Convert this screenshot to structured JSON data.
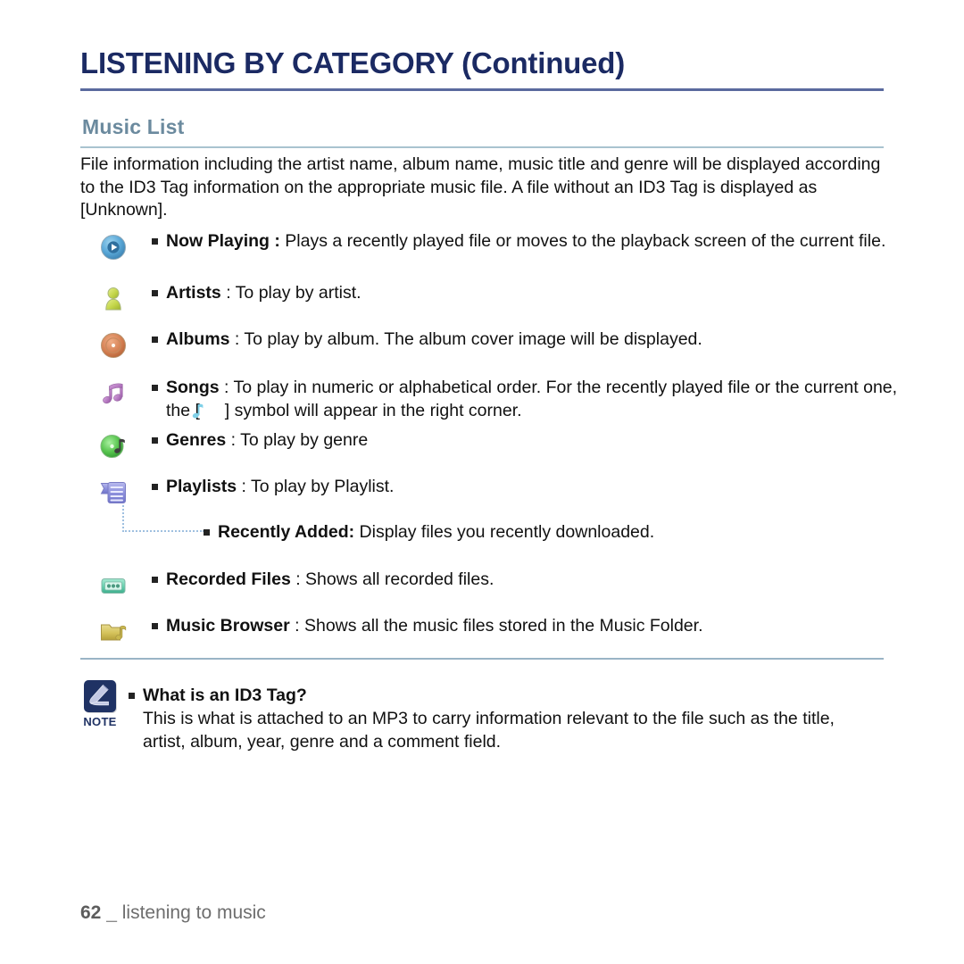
{
  "header": {
    "title": "LISTENING BY CATEGORY (Continued)",
    "section_title": "Music List"
  },
  "intro": "File information including the artist name, album name, music title and genre will be displayed according to the ID3 Tag information on the appropriate music file. A file without an ID3 Tag is displayed as [Unknown].",
  "features": [
    {
      "icon": "now-playing-icon",
      "term": "Now Playing :",
      "desc": " Plays a recently played file or moves to the playback screen of the current file."
    },
    {
      "icon": "artists-icon",
      "term": "Artists",
      "desc": " : To play by artist."
    },
    {
      "icon": "albums-icon",
      "term": "Albums",
      "desc": " : To play by album. The album cover image will be displayed."
    },
    {
      "icon": "songs-icon",
      "term": "Songs",
      "desc_before": " : To play in numeric or alphabetical order. For the recently played file or the current one, the [ ",
      "desc_after": " ] symbol will appear in the right corner."
    },
    {
      "icon": "genres-icon",
      "term": "Genres",
      "desc": " : To play by genre"
    },
    {
      "icon": "playlists-icon",
      "term": "Playlists",
      "desc": " : To play by Playlist."
    },
    {
      "icon": "recorded-files-icon",
      "term": "Recorded Files",
      "desc": " : Shows all recorded files."
    },
    {
      "icon": "music-browser-icon",
      "term": "Music Browser",
      "desc": " : Shows all the music files stored in the Music Folder."
    }
  ],
  "subfeature": {
    "term": "Recently Added:",
    "desc": " Display files you recently downloaded."
  },
  "note": {
    "icon": "note-hand-icon",
    "badge_label": "NOTE",
    "heading": "What is an ID3 Tag?",
    "body": "This is what is attached to an MP3 to carry information relevant to the file such as the title, artist, album, year, genre and a comment field."
  },
  "footer": {
    "page_number": "62",
    "separator": "_",
    "chapter": "listening to music"
  },
  "colors": {
    "title": "#1b2a63",
    "title_rule": "#5a6a9e",
    "section_title": "#6b8a9e",
    "section_rule": "#a9c3cf",
    "note_rule": "#9ab4c6",
    "note_badge": "#1f3264",
    "connector": "#9fc0e0",
    "body_text": "#111111",
    "footer_text": "#6e6e6e"
  }
}
